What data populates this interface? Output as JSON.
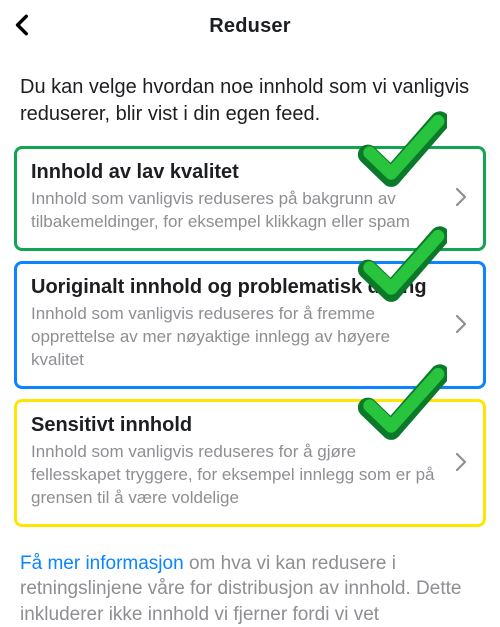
{
  "header": {
    "title": "Reduser"
  },
  "intro": "Du kan velge hvordan noe innhold som vi vanligvis reduserer, blir vist i din egen feed.",
  "items": [
    {
      "title": "Innhold av lav kvalitet",
      "desc": "Innhold som vanligvis reduseres på bakgrunn av tilbakemeldinger, for eksempel klikkagn eller spam"
    },
    {
      "title": "Uoriginalt innhold og problematisk deling",
      "desc": "Innhold som vanligvis reduseres for å fremme opprettelse av mer nøyaktige innlegg av høyere kvalitet"
    },
    {
      "title": "Sensitivt innhold",
      "desc": "Innhold som vanligvis reduseres for å gjøre fellesskapet tryggere, for eksempel innlegg som er på grensen til å være voldelige"
    }
  ],
  "footer": {
    "link_text": "Få mer informasjon",
    "rest": " om hva vi kan redusere i retningslinjene våre for distribusjon av innhold. Dette inkluderer ikke innhold vi fjerner fordi vi vet"
  }
}
